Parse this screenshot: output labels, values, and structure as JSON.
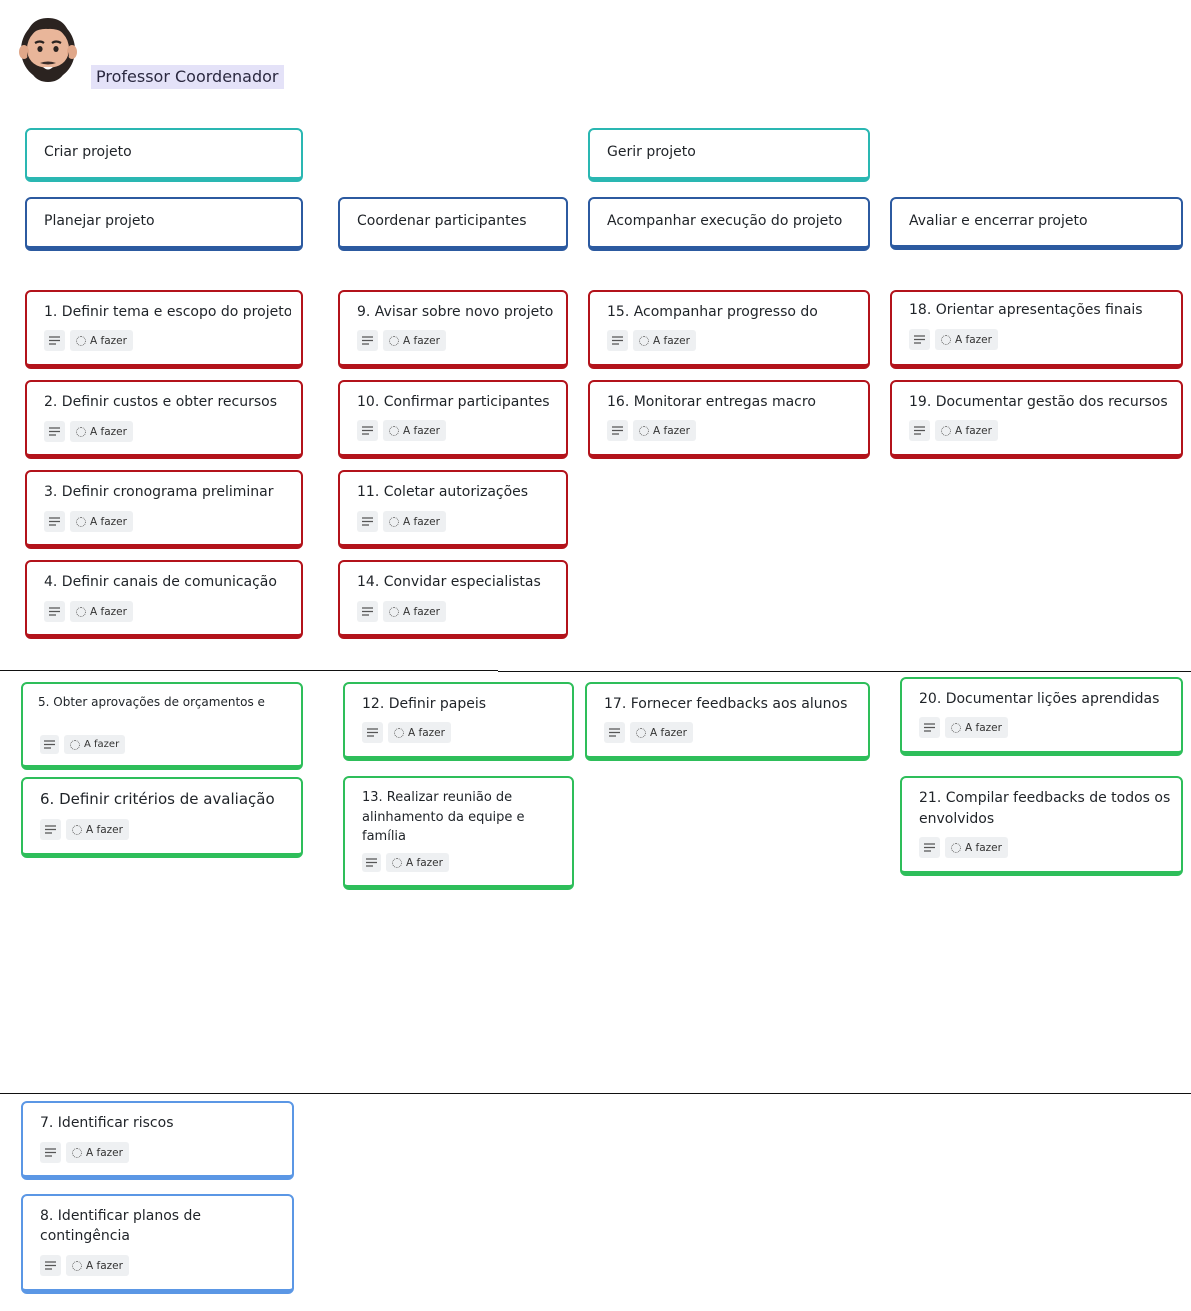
{
  "persona": {
    "name": "Professor Coordenador",
    "avatar_icon": "bearded-man-avatar-icon"
  },
  "status_label": "A fazer",
  "activities": [
    {
      "title": "Criar projeto"
    },
    {
      "title": "Gerir projeto"
    }
  ],
  "steps": [
    {
      "title": "Planejar projeto"
    },
    {
      "title": "Coordenar participantes"
    },
    {
      "title": "Acompanhar execução do projeto"
    },
    {
      "title": "Avaliar e encerrar projeto"
    }
  ],
  "tasks": {
    "t1": {
      "title": "1. Definir tema e escopo do projeto",
      "status": "A fazer"
    },
    "t2": {
      "title": "2. Definir custos e obter recursos",
      "status": "A fazer"
    },
    "t3": {
      "title": "3. Definir cronograma preliminar",
      "status": "A fazer"
    },
    "t4": {
      "title": "4. Definir canais de comunicação",
      "status": "A fazer"
    },
    "t5": {
      "title": "5. Obter aprovações de orçamentos e",
      "status": "A fazer"
    },
    "t6": {
      "title": "6. Definir critérios de avaliação",
      "status": "A fazer"
    },
    "t7": {
      "title": "7. Identificar riscos",
      "status": "A fazer"
    },
    "t8": {
      "title": "8. Identificar planos de contingência",
      "status": "A fazer"
    },
    "t9": {
      "title": "9. Avisar sobre novo projeto",
      "status": "A fazer"
    },
    "t10": {
      "title": "10. Confirmar participantes",
      "status": "A fazer"
    },
    "t11": {
      "title": "11. Coletar autorizações",
      "status": "A fazer"
    },
    "t12": {
      "title": "12. Definir papeis",
      "status": "A fazer"
    },
    "t13": {
      "title": "13. Realizar reunião de alinhamento da equipe e família",
      "status": "A fazer"
    },
    "t14": {
      "title": "14. Convidar especialistas",
      "status": "A fazer"
    },
    "t15": {
      "title": "15. Acompanhar progresso do",
      "status": "A fazer"
    },
    "t16": {
      "title": "16. Monitorar entregas macro",
      "status": "A fazer"
    },
    "t17": {
      "title": "17. Fornecer feedbacks aos alunos",
      "status": "A fazer"
    },
    "t18": {
      "title": "18. Orientar apresentações finais",
      "status": "A fazer"
    },
    "t19": {
      "title": "19. Documentar gestão dos recursos",
      "status": "A fazer"
    },
    "t20": {
      "title": "20. Documentar lições aprendidas",
      "status": "A fazer"
    },
    "t21": {
      "title": "21. Compilar feedbacks de todos os envolvidos",
      "status": "A fazer"
    }
  },
  "colors": {
    "activity_border": "#2ab7b2",
    "step_border": "#2c5aa0",
    "release1_border": "#b3131b",
    "release2_border": "#2ebe5a",
    "release3_border": "#5b97e5",
    "persona_highlight": "#e4e2f8"
  }
}
